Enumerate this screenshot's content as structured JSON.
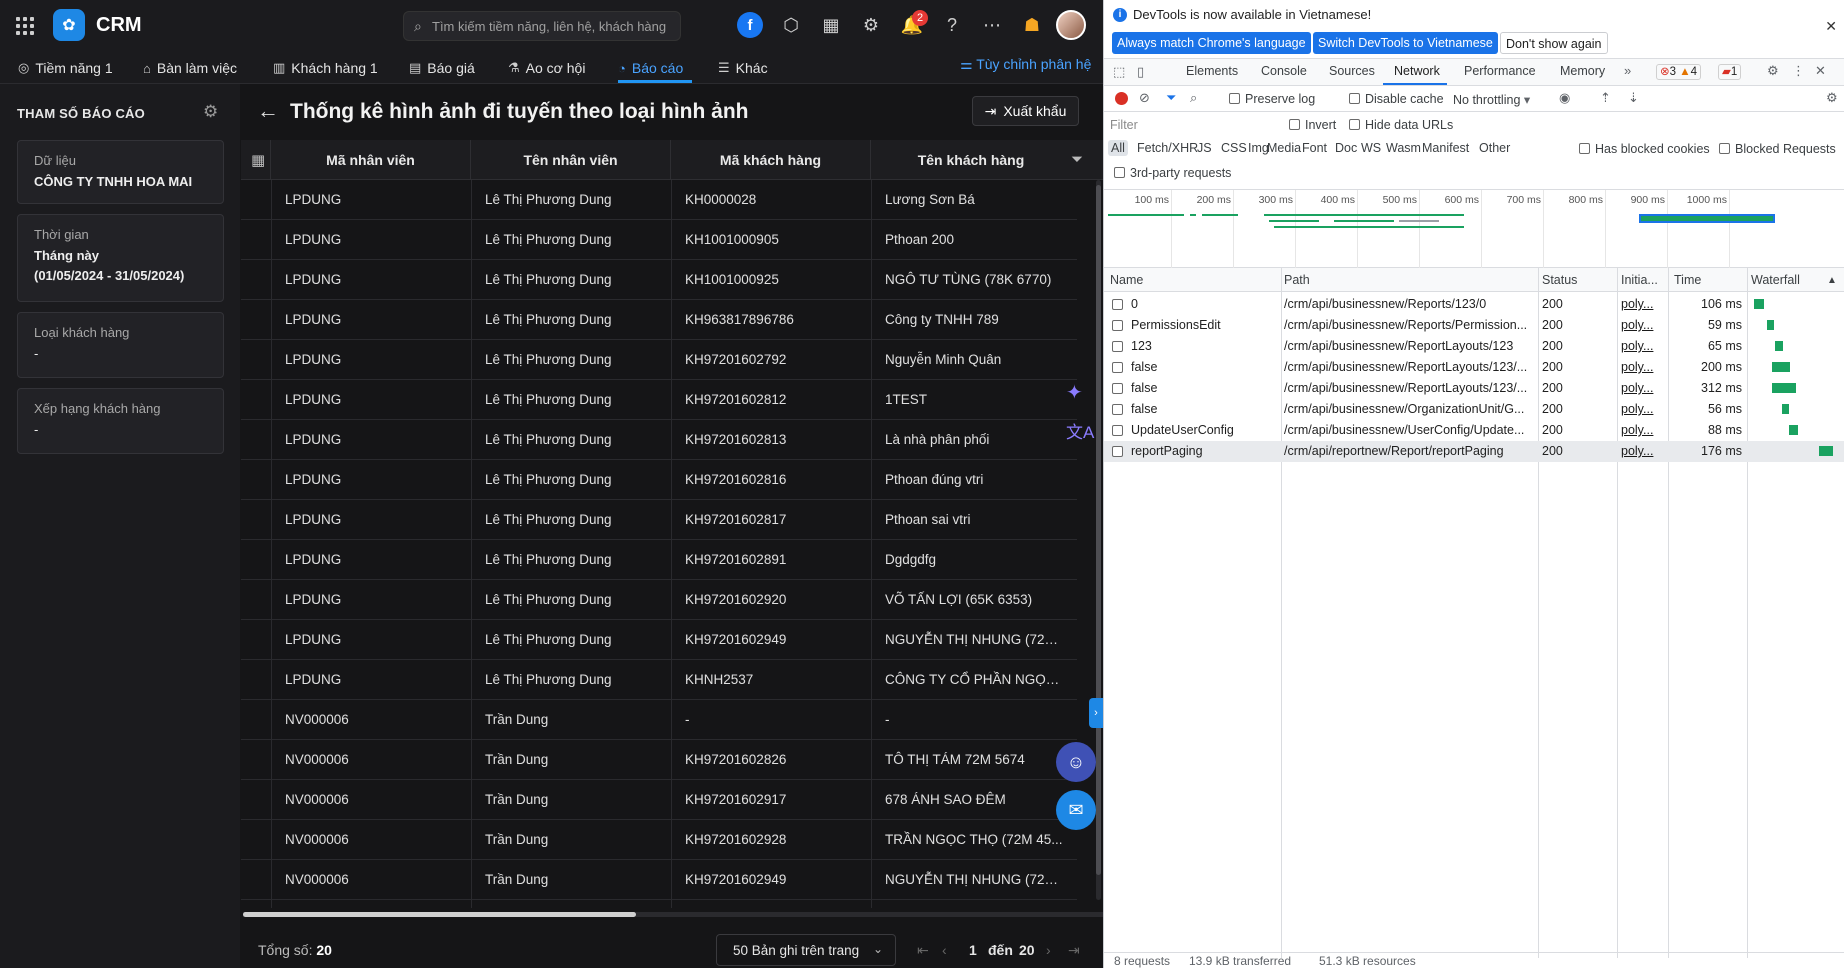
{
  "app": {
    "title": "CRM",
    "search_placeholder": "Tìm kiếm tiềm năng, liên hệ, khách hàng",
    "notif_count": "2",
    "header_icons": [
      "facebook-icon",
      "box-icon",
      "calendar-icon",
      "gear-icon",
      "bell-icon",
      "help-icon",
      "chat-icon",
      "gift-icon"
    ],
    "nav": [
      {
        "icon": "user-icon",
        "label": "Tiềm năng 1"
      },
      {
        "icon": "briefcase-icon",
        "label": "Bàn làm việc"
      },
      {
        "icon": "building-icon",
        "label": "Khách hàng 1"
      },
      {
        "icon": "document-icon",
        "label": "Báo giá"
      },
      {
        "icon": "flask-icon",
        "label": "Ao cơ hội"
      },
      {
        "icon": "pie-chart-icon",
        "label": "Báo cáo"
      },
      {
        "icon": "menu-icon",
        "label": "Khác"
      }
    ],
    "customize_label": "Tùy chỉnh phân hệ"
  },
  "params": {
    "title": "THAM SỐ BÁO CÁO",
    "cards": [
      {
        "label": "Dữ liệu",
        "value": "CÔNG TY TNHH HOA MAI"
      },
      {
        "label": "Thời gian",
        "value": "Tháng này",
        "value2": "(01/05/2024 - 31/05/2024)"
      },
      {
        "label": "Loại khách hàng",
        "value": "-"
      },
      {
        "label": "Xếp hạng khách hàng",
        "value": "-"
      }
    ]
  },
  "report": {
    "title": "Thống kê hình ảnh đi tuyến theo loại hình ảnh",
    "export_label": "Xuất khẩu",
    "columns": [
      "Mã nhân viên",
      "Tên nhân viên",
      "Mã khách hàng",
      "Tên khách hàng"
    ],
    "rows": [
      [
        "LPDUNG",
        "Lê Thị Phương Dung",
        "KH0000028",
        "Lương Sơn Bá"
      ],
      [
        "LPDUNG",
        "Lê Thị Phương Dung",
        "KH1001000905",
        "Pthoan 200"
      ],
      [
        "LPDUNG",
        "Lê Thị Phương Dung",
        "KH1001000925",
        "NGÔ TƯ TÙNG (78K 6770)"
      ],
      [
        "LPDUNG",
        "Lê Thị Phương Dung",
        "KH963817896786",
        "Công ty TNHH 789"
      ],
      [
        "LPDUNG",
        "Lê Thị Phương Dung",
        "KH97201602792",
        "Nguyễn Minh Quân"
      ],
      [
        "LPDUNG",
        "Lê Thị Phương Dung",
        "KH97201602812",
        "1TEST"
      ],
      [
        "LPDUNG",
        "Lê Thị Phương Dung",
        "KH97201602813",
        "Là nhà phân phối"
      ],
      [
        "LPDUNG",
        "Lê Thị Phương Dung",
        "KH97201602816",
        "Pthoan đúng vtri"
      ],
      [
        "LPDUNG",
        "Lê Thị Phương Dung",
        "KH97201602817",
        "Pthoan sai vtri"
      ],
      [
        "LPDUNG",
        "Lê Thị Phương Dung",
        "KH97201602891",
        "Dgdgdfg"
      ],
      [
        "LPDUNG",
        "Lê Thị Phương Dung",
        "KH97201602920",
        "VÕ TẤN LỢI (65K 6353)"
      ],
      [
        "LPDUNG",
        "Lê Thị Phương Dung",
        "KH97201602949",
        "NGUYỄN THỊ NHUNG (72M..."
      ],
      [
        "LPDUNG",
        "Lê Thị Phương Dung",
        "KHNH2537",
        "CÔNG TY CỔ PHẦN NGỌN ..."
      ],
      [
        "NV000006",
        "Trần Dung",
        "-",
        "-"
      ],
      [
        "NV000006",
        "Trần Dung",
        "KH97201602826",
        "TÔ THỊ TÁM 72M 5674"
      ],
      [
        "NV000006",
        "Trần Dung",
        "KH97201602917",
        "678 ÁNH SAO ĐÊM"
      ],
      [
        "NV000006",
        "Trần Dung",
        "KH97201602928",
        "TRẦN NGỌC THỌ (72M 45..."
      ],
      [
        "NV000006",
        "Trần Dung",
        "KH97201602949",
        "NGUYỄN THỊ NHUNG (72M..."
      ]
    ],
    "total_label": "Tổng số:",
    "total_value": "20",
    "page_size_label": "50 Bản ghi trên trang",
    "page_from": "1",
    "page_to_label": "đến",
    "page_to": "20"
  },
  "devtools": {
    "info_msg": "DevTools is now available in Vietnamese!",
    "btn_match": "Always match Chrome's language",
    "btn_switch": "Switch DevTools to Vietnamese",
    "btn_dont": "Don't show again",
    "tabs": [
      "Elements",
      "Console",
      "Sources",
      "Network",
      "Performance",
      "Memory"
    ],
    "errors": "3",
    "warnings": "4",
    "issues": "1",
    "preserve_log": "Preserve log",
    "disable_cache": "Disable cache",
    "throttling": "No throttling",
    "filter_placeholder": "Filter",
    "invert": "Invert",
    "hide_data_urls": "Hide data URLs",
    "types": [
      "All",
      "Fetch/XHR",
      "JS",
      "CSS",
      "Img",
      "Media",
      "Font",
      "Doc",
      "WS",
      "Wasm",
      "Manifest",
      "Other"
    ],
    "has_blocked_cookies": "Has blocked cookies",
    "blocked_requests": "Blocked Requests",
    "third_party": "3rd-party requests",
    "ticks": [
      "100 ms",
      "200 ms",
      "300 ms",
      "400 ms",
      "500 ms",
      "600 ms",
      "700 ms",
      "800 ms",
      "900 ms",
      "1000 ms"
    ],
    "columns": [
      "Name",
      "Path",
      "Status",
      "Initia...",
      "Time",
      "Waterfall"
    ],
    "requests": [
      {
        "name": "0",
        "path": "/crm/api/businessnew/Reports/123/0",
        "status": "200",
        "init": "poly...",
        "time": "106 ms"
      },
      {
        "name": "PermissionsEdit",
        "path": "/crm/api/businessnew/Reports/Permission...",
        "status": "200",
        "init": "poly...",
        "time": "59 ms"
      },
      {
        "name": "123",
        "path": "/crm/api/businessnew/ReportLayouts/123",
        "status": "200",
        "init": "poly...",
        "time": "65 ms"
      },
      {
        "name": "false",
        "path": "/crm/api/businessnew/ReportLayouts/123/...",
        "status": "200",
        "init": "poly...",
        "time": "200 ms"
      },
      {
        "name": "false",
        "path": "/crm/api/businessnew/ReportLayouts/123/...",
        "status": "200",
        "init": "poly...",
        "time": "312 ms"
      },
      {
        "name": "false",
        "path": "/crm/api/businessnew/OrganizationUnit/G...",
        "status": "200",
        "init": "poly...",
        "time": "56 ms"
      },
      {
        "name": "UpdateUserConfig",
        "path": "/crm/api/businessnew/UserConfig/Update...",
        "status": "200",
        "init": "poly...",
        "time": "88 ms"
      },
      {
        "name": "reportPaging",
        "path": "/crm/api/reportnew/Report/reportPaging",
        "status": "200",
        "init": "poly...",
        "time": "176 ms"
      }
    ],
    "status_requests": "8 requests",
    "status_transferred": "13.9 kB transferred",
    "status_resources": "51.3 kB resources"
  }
}
